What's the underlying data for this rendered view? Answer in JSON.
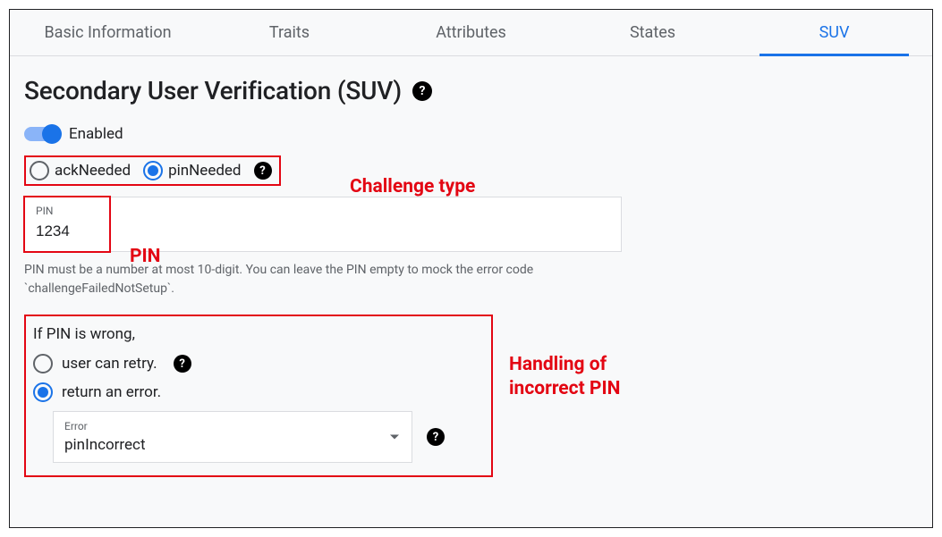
{
  "tabs": [
    {
      "label": "Basic Information"
    },
    {
      "label": "Traits"
    },
    {
      "label": "Attributes"
    },
    {
      "label": "States"
    },
    {
      "label": "SUV"
    }
  ],
  "heading": "Secondary User Verification (SUV)",
  "toggle": {
    "label": "Enabled",
    "value": true
  },
  "challenge_type": {
    "options": [
      {
        "key": "ackNeeded",
        "label": "ackNeeded",
        "checked": false
      },
      {
        "key": "pinNeeded",
        "label": "pinNeeded",
        "checked": true
      }
    ]
  },
  "pin": {
    "float_label": "PIN",
    "value": "1234",
    "hint": "PIN must be a number at most 10-digit. You can leave the PIN empty to mock the error code `challengeFailedNotSetup`."
  },
  "error_handling": {
    "prompt": "If PIN is wrong,",
    "options": [
      {
        "label": "user can retry.",
        "checked": false,
        "has_help": true
      },
      {
        "label": "return an error.",
        "checked": true,
        "has_help": false
      }
    ],
    "error_select": {
      "float_label": "Error",
      "value": "pinIncorrect"
    }
  },
  "annotations": {
    "challenge_type": "Challenge type",
    "pin": "PIN",
    "incorrect_pin": "Handling of\nincorrect PIN"
  },
  "colors": {
    "accent": "#1a73e8",
    "callout": "#e30613",
    "text_secondary": "#5f6368"
  }
}
